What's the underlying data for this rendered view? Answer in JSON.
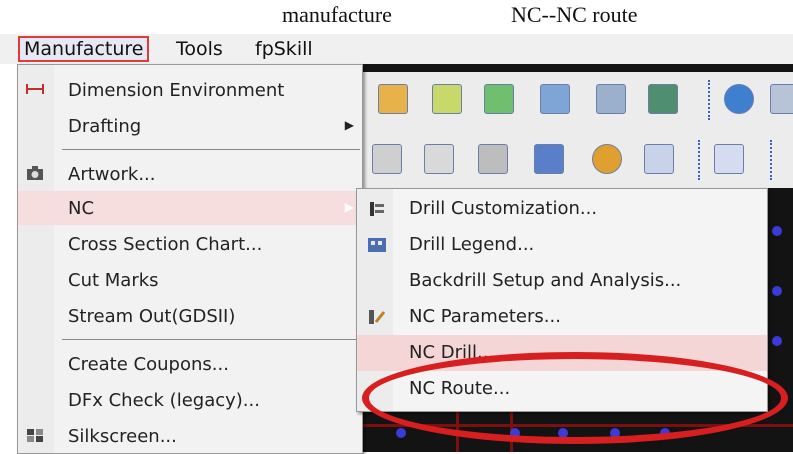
{
  "captions": {
    "left": "manufacture",
    "right": "NC--NC  route"
  },
  "menubar": {
    "items": [
      "Manufacture",
      "Tools",
      "fpSkill"
    ]
  },
  "manufacture_menu": {
    "items": [
      {
        "label": "Dimension Environment",
        "icon": "dimension-icon"
      },
      {
        "label": "Drafting",
        "submenu": true
      },
      {
        "label": "Artwork...",
        "icon": "camera-icon"
      },
      {
        "label": "NC",
        "submenu": true,
        "highlighted": true
      },
      {
        "label": "Cross Section Chart..."
      },
      {
        "label": "Cut Marks"
      },
      {
        "label": "Stream Out(GDSII)"
      },
      {
        "label": "Create Coupons..."
      },
      {
        "label": "DFx Check (legacy)..."
      },
      {
        "label": "Silkscreen...",
        "icon": "silkscreen-icon"
      }
    ]
  },
  "nc_submenu": {
    "items": [
      {
        "label": "Drill Customization...",
        "icon": "drill-customization-icon"
      },
      {
        "label": "Drill Legend...",
        "icon": "drill-legend-icon"
      },
      {
        "label": "Backdrill Setup and Analysis..."
      },
      {
        "label": "NC Parameters...",
        "icon": "nc-parameters-icon"
      },
      {
        "label": "NC Drill...",
        "highlighted": true
      },
      {
        "label": "NC Route...",
        "annotated": true
      }
    ]
  },
  "colors": {
    "highlight": "#f5d6d6",
    "annotation_ring": "#d81f1f",
    "menu_border": "#e03a3a"
  }
}
